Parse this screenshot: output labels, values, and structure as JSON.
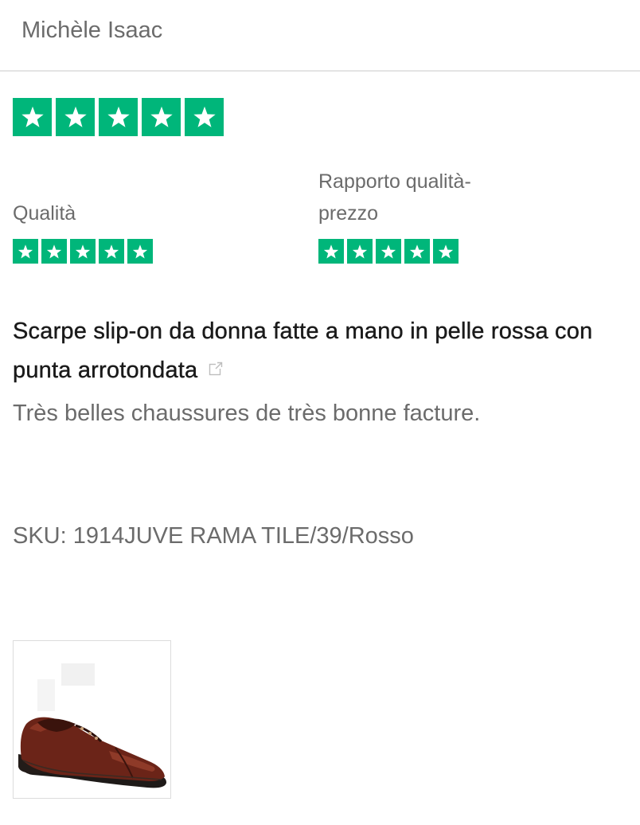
{
  "review": {
    "reviewer_name": "Michèle Isaac",
    "overall_rating": 5,
    "quality_label": "Qualità",
    "quality_rating": 5,
    "value_label": "Rapporto qualità-prezzo",
    "value_rating": 5,
    "product_title": "Scarpe slip-on da donna fatte a mano in pelle rossa con punta arrotondata",
    "body": "Très belles chaussures de très bonne facture.",
    "sku_label": "SKU:",
    "sku_value": "1914JUVE RAMA TILE/39/Rosso"
  },
  "colors": {
    "star_green": "#00b67a"
  },
  "icons": {
    "star": "star-icon",
    "external_link": "external-link-icon"
  }
}
